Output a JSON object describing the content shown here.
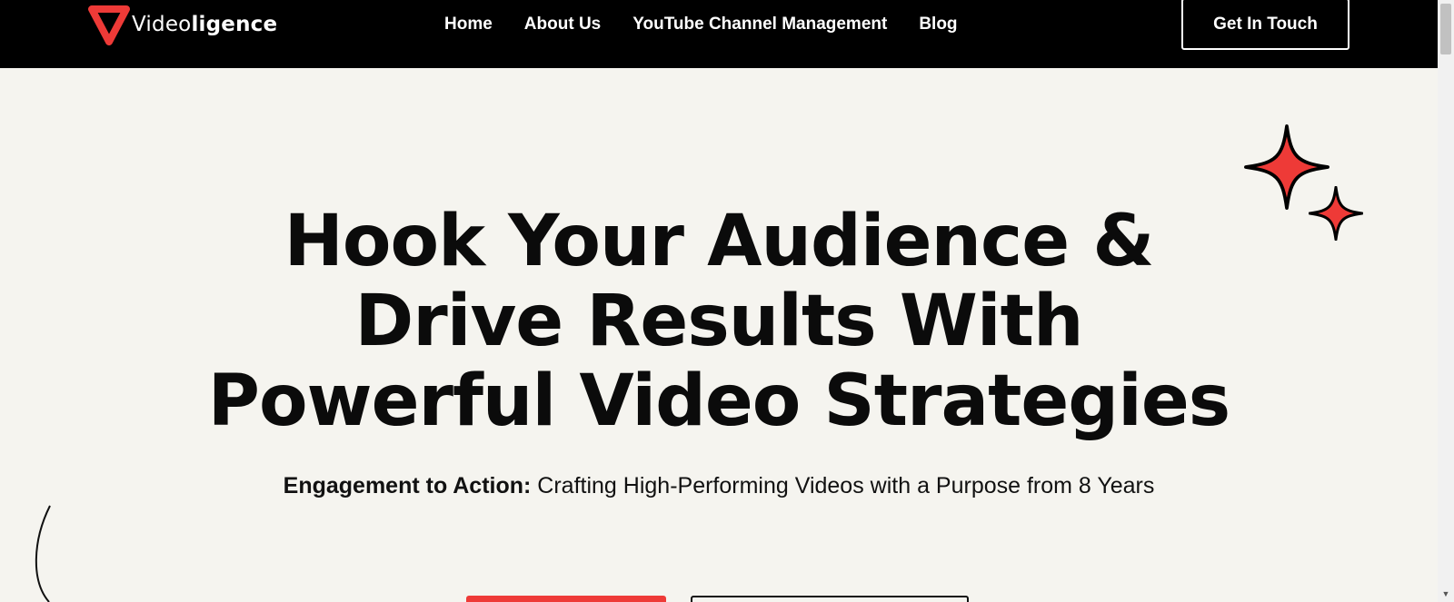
{
  "brand": {
    "name_part1": "Video",
    "name_part2": "ligence",
    "accent_color": "#ee3a37"
  },
  "nav": {
    "items": [
      {
        "label": "Home"
      },
      {
        "label": "About Us"
      },
      {
        "label": "YouTube Channel Management"
      },
      {
        "label": "Blog"
      }
    ],
    "cta_label": "Get In Touch"
  },
  "hero": {
    "headline_lines": [
      "Hook Your Audience &",
      "Drive Results With",
      "Powerful Video Strategies"
    ],
    "subline_bold": "Engagement to Action:",
    "subline_text": " Crafting High-Performing Videos with a Purpose from 8 Years"
  },
  "icons": {
    "logo": "play-triangle-logo-icon",
    "decor1": "sparkle-icon",
    "decor2": "curve-line-decoration"
  }
}
